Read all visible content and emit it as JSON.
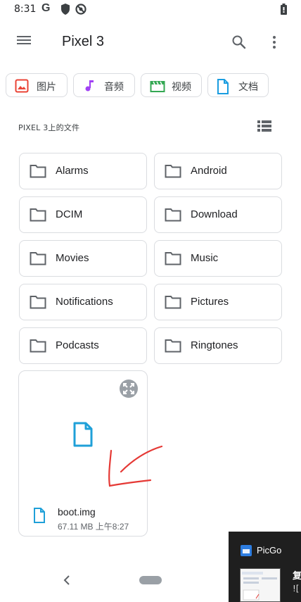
{
  "status_bar": {
    "time": "8:31",
    "g_label": "G",
    "icons": [
      "google-icon",
      "shield-icon",
      "sync-off-icon",
      "battery-icon"
    ]
  },
  "app_bar": {
    "title": "Pixel 3",
    "icons": [
      "menu-icon",
      "search-icon",
      "more-vert-icon"
    ]
  },
  "chips": [
    {
      "label": "图片",
      "icon": "image-icon",
      "color": "#ea4335"
    },
    {
      "label": "音频",
      "icon": "music-note-icon",
      "color": "#a142f4"
    },
    {
      "label": "视频",
      "icon": "movie-icon",
      "color": "#34a853"
    },
    {
      "label": "文档",
      "icon": "document-icon",
      "color": "#1a73e8"
    }
  ],
  "section": {
    "title": "PIXEL 3上的文件",
    "view_icon": "list-view-icon"
  },
  "folders": [
    {
      "label": "Alarms"
    },
    {
      "label": "Android"
    },
    {
      "label": "DCIM"
    },
    {
      "label": "Download"
    },
    {
      "label": "Movies"
    },
    {
      "label": "Music"
    },
    {
      "label": "Notifications"
    },
    {
      "label": "Pictures"
    },
    {
      "label": "Podcasts"
    },
    {
      "label": "Ringtones"
    }
  ],
  "file": {
    "name": "boot.img",
    "meta": "67.11 MB 上午8:27",
    "icon": "file-icon",
    "accent": "#1fa0d8"
  },
  "notification": {
    "app": "PicGo",
    "title": "复",
    "body": "![",
    "icon": "picgo-icon"
  },
  "nav": {
    "icons": [
      "back-icon",
      "home-pill"
    ]
  },
  "colors": {
    "outline": "#dadce0",
    "icon_gray": "#5f6368",
    "annotation": "#e53935"
  }
}
